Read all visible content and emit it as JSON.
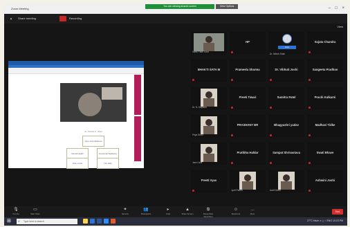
{
  "window": {
    "title": "Zoom Meeting"
  },
  "toolbar_top": {
    "items": [
      "▲",
      "Share meeting",
      "●",
      "Recording"
    ],
    "share_banner": "You are viewing shared screen",
    "stop_label": "View Options",
    "view_label": "View"
  },
  "shared": {
    "caption": "Dr. Nishita N. Shah",
    "boxes": [
      "Vayu Jyoti Wellness",
      "Mental Health",
      "Emotional Wellbeing",
      "Role model",
      "Life skills"
    ]
  },
  "participants": [
    {
      "type": "video",
      "label": "Vanik Patel Tutor"
    },
    {
      "type": "name",
      "name": "HP"
    },
    {
      "type": "logo",
      "label": "Dr. Nilesh Shah",
      "badge": "Host"
    },
    {
      "type": "name",
      "name": "Sujata Chandra"
    },
    {
      "type": "name",
      "name": "BHAKTI SATA M"
    },
    {
      "type": "name",
      "name": "Prameela Sharma"
    },
    {
      "type": "name",
      "name": "Dr. Vibhuti Joshi"
    },
    {
      "type": "name",
      "name": "Sangeeta Pradhan"
    },
    {
      "type": "video",
      "label": "Dr. N. Kapadia"
    },
    {
      "type": "name",
      "name": "Preeti Tiwari"
    },
    {
      "type": "name",
      "name": "Sumitra Patel"
    },
    {
      "type": "name",
      "name": "Prachi Kulkarni"
    },
    {
      "type": "video",
      "label": "Priya Shah"
    },
    {
      "type": "name",
      "name": "PRASHANT BR"
    },
    {
      "type": "name",
      "name": "Bhagyashri yadav"
    },
    {
      "type": "name",
      "name": "Madhavi Tidke"
    },
    {
      "type": "video",
      "label": "Janvi Jani"
    },
    {
      "type": "name",
      "name": "Pratibha Haldar"
    },
    {
      "type": "name",
      "name": "Sampat Shrivastava"
    },
    {
      "type": "name",
      "name": "Swati Bhave"
    },
    {
      "type": "name",
      "name": "Preeti Vyas"
    },
    {
      "type": "video",
      "label": "Jyoti Parikh"
    },
    {
      "type": "video",
      "label": "Aarti Desai"
    },
    {
      "type": "name",
      "name": "Ashwini Joshi"
    }
  ],
  "bottom_toolbar": {
    "items": [
      {
        "icon": "mic-icon",
        "glyph": "🎙",
        "label": "Unmute"
      },
      {
        "icon": "camera-icon",
        "glyph": "▭",
        "label": "Start Video"
      },
      {
        "icon": "security-icon",
        "glyph": "✦",
        "label": "Security"
      },
      {
        "icon": "participants-icon",
        "glyph": "👥",
        "label": "Participants"
      },
      {
        "icon": "chat-icon",
        "glyph": "▸",
        "label": "Chat"
      },
      {
        "icon": "share-icon",
        "glyph": "▲",
        "label": "Share Screen"
      },
      {
        "icon": "record-icon",
        "glyph": "⧉",
        "label": "Pause/Stop Recording"
      },
      {
        "icon": "reactions-icon",
        "glyph": "☺",
        "label": "Reactions"
      },
      {
        "icon": "more-icon",
        "glyph": "…",
        "label": "More"
      }
    ],
    "end_label": "End"
  },
  "taskbar": {
    "search_placeholder": "Type here to search",
    "tray_text": "27°C Haze ∧ ◻ ⌁ ENG 10:23 PM"
  },
  "colors": {
    "accent": "#2d74d9",
    "record": "#c62828",
    "share_green": "#1f8f3a",
    "end": "#d32f2f"
  }
}
